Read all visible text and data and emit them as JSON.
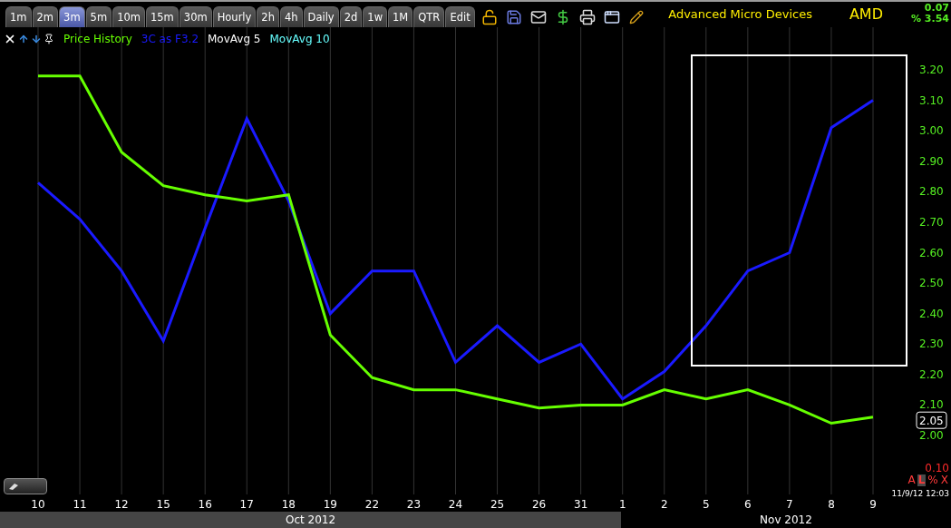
{
  "toolbar": {
    "tabs": [
      {
        "label": "1m",
        "selected": false
      },
      {
        "label": "2m",
        "selected": false
      },
      {
        "label": "3m",
        "selected": true
      },
      {
        "label": "5m",
        "selected": false
      },
      {
        "label": "10m",
        "selected": false
      },
      {
        "label": "15m",
        "selected": false
      },
      {
        "label": "30m",
        "selected": false
      },
      {
        "label": "Hourly",
        "selected": false
      },
      {
        "label": "2h",
        "selected": false
      },
      {
        "label": "4h",
        "selected": false
      },
      {
        "label": "Daily",
        "selected": false
      },
      {
        "label": "2d",
        "selected": false
      },
      {
        "label": "1w",
        "selected": false
      },
      {
        "label": "1M",
        "selected": false
      },
      {
        "label": "QTR",
        "selected": false
      },
      {
        "label": "Edit",
        "selected": false
      }
    ]
  },
  "header": {
    "name": "Advanced Micro Devices",
    "symbol": "AMD",
    "change": "0.07",
    "percent_change": "% 3.54"
  },
  "legend": {
    "items": [
      {
        "label": "MovAvg 5",
        "color": "#ffffff"
      },
      {
        "label": "MovAvg 10",
        "color": "#66ffff"
      }
    ]
  },
  "chart": {
    "last_price": "2.05",
    "chart_data": {
      "type": "line",
      "grid": true,
      "ylim": [
        2.0,
        3.2
      ],
      "categories": [
        "10",
        "11",
        "12",
        "15",
        "16",
        "17",
        "18",
        "19",
        "22",
        "23",
        "24",
        "25",
        "26",
        "31",
        "1",
        "2",
        "5",
        "6",
        "7",
        "8",
        "9"
      ],
      "series": [
        {
          "name": "Price History",
          "color": "#66ff00",
          "values": [
            3.18,
            3.18,
            2.93,
            2.82,
            2.79,
            2.77,
            2.79,
            2.33,
            2.19,
            2.15,
            2.15,
            2.12,
            2.09,
            2.1,
            2.1,
            2.15,
            2.12,
            2.15,
            2.1,
            2.04,
            2.06
          ]
        },
        {
          "name": "3C as F3.2",
          "color": "#1a1aff",
          "values": [
            2.83,
            2.71,
            2.54,
            2.31,
            2.68,
            3.04,
            2.77,
            2.4,
            2.54,
            2.54,
            2.24,
            2.36,
            2.24,
            2.3,
            2.12,
            2.21,
            2.36,
            2.54,
            2.6,
            3.01,
            3.1
          ]
        }
      ],
      "yticks": [
        {
          "value": 2.0,
          "label": "2.00"
        },
        {
          "value": 2.1,
          "label": "2.10"
        },
        {
          "value": 2.2,
          "label": "2.20"
        },
        {
          "value": 2.3,
          "label": "2.30"
        },
        {
          "value": 2.4,
          "label": "2.40"
        },
        {
          "value": 2.5,
          "label": "2.50"
        },
        {
          "value": 2.6,
          "label": "2.60"
        },
        {
          "value": 2.7,
          "label": "2.70"
        },
        {
          "value": 2.8,
          "label": "2.80"
        },
        {
          "value": 2.9,
          "label": "2.90"
        },
        {
          "value": 3.0,
          "label": "3.00"
        },
        {
          "value": 3.1,
          "label": "3.10"
        },
        {
          "value": 3.2,
          "label": "3.20"
        }
      ]
    }
  },
  "scale_panel": {
    "value": "0.10",
    "buttons": [
      {
        "label": "A",
        "selected": false
      },
      {
        "label": "L",
        "selected": true
      },
      {
        "label": "%",
        "selected": false
      },
      {
        "label": "X",
        "selected": false
      }
    ],
    "timestamp": "11/9/12 12:03"
  },
  "months": [
    {
      "label": "Oct 2012",
      "shaded": true
    },
    {
      "label": "Nov 2012",
      "shaded": false
    }
  ]
}
